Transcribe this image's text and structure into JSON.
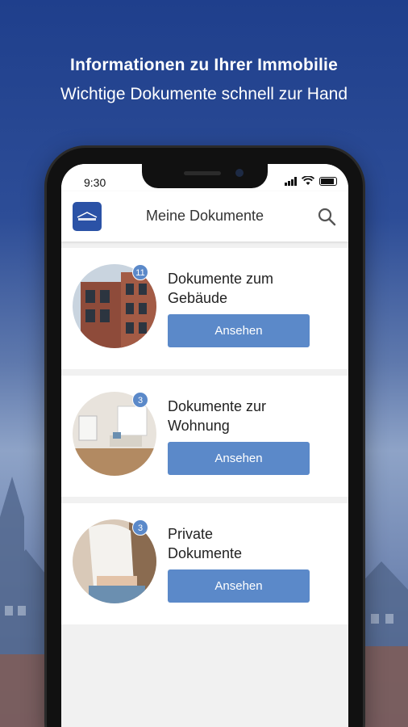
{
  "headline": {
    "title": "Informationen zu Ihrer Immobilie",
    "subtitle": "Wichtige Dokumente schnell zur Hand"
  },
  "status_bar": {
    "time": "9:30"
  },
  "app_bar": {
    "logo_icon": "veromo-logo-icon",
    "title": "Meine Dokumente",
    "search_icon": "search-icon"
  },
  "colors": {
    "brand": "#2b52a6",
    "button": "#5b89c9",
    "background_top": "#1f3f8c"
  },
  "cards": [
    {
      "title": "Dokumente zum\nGebäude",
      "count": "11",
      "button_label": "Ansehen",
      "thumb_icon": "building-photo"
    },
    {
      "title": "Dokumente zur\nWohnung",
      "count": "3",
      "button_label": "Ansehen",
      "thumb_icon": "apartment-photo"
    },
    {
      "title": "Private\nDokumente",
      "count": "3",
      "button_label": "Ansehen",
      "thumb_icon": "person-photo"
    }
  ]
}
